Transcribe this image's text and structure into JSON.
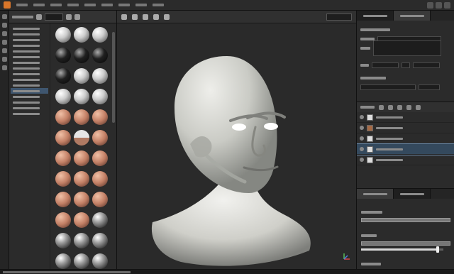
{
  "colors": {
    "app_orange": "#d9762a",
    "panel_dark": "#2b2b2b",
    "viewport": "#2a2a2a",
    "model": "#d6d7d0",
    "selection": "#34495d"
  },
  "icons": {
    "app": "app-logo-icon",
    "filter": "filter-icon",
    "visibility": "eye-icon",
    "axis": "axis-gizmo-icon"
  },
  "controls": {
    "slider_level": 0.93
  }
}
